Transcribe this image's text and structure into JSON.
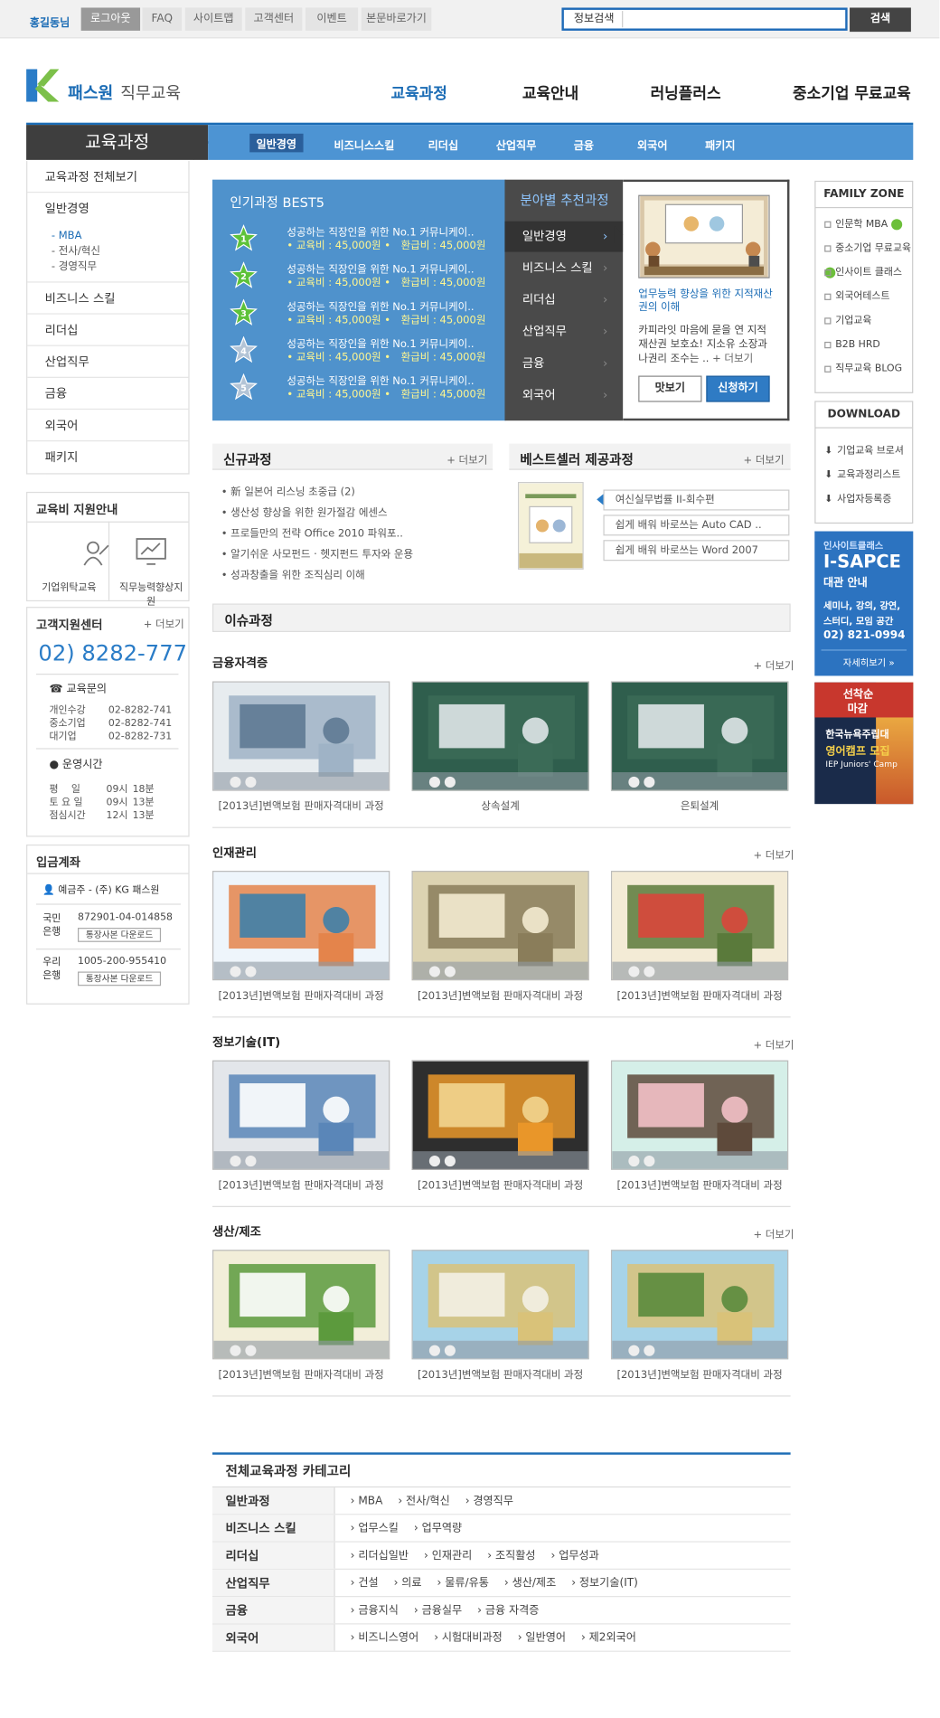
{
  "topbar": {
    "user": "홍길동님",
    "links": [
      "로그아웃",
      "FAQ",
      "사이트맵",
      "고객센터",
      "이벤트",
      "본문바로가기"
    ],
    "search_label": "정보검색",
    "search_value": "",
    "search_button": "검색"
  },
  "header": {
    "brand": "패스원",
    "brand_sub": "직무교육",
    "gnb": [
      "교육과정",
      "교육안내",
      "러닝플러스",
      "중소기업 무료교육"
    ]
  },
  "submenu": {
    "title": "교육과정",
    "items": [
      "일반경영",
      "비즈니스스킬",
      "리더십",
      "산업직무",
      "금융",
      "외국어",
      "패키지"
    ]
  },
  "left_nav": {
    "items": [
      "교육과정 전체보기",
      "일반경영"
    ],
    "subitems": [
      "MBA",
      "전사/혁신",
      "경영직무"
    ],
    "items2": [
      "비즈니스 스킬",
      "리더십",
      "산업직무",
      "금융",
      "외국어",
      "패키지"
    ]
  },
  "support": {
    "title": "교육비 지원안내",
    "items": [
      "기업위탁교육",
      "직무능력향상지원"
    ]
  },
  "customer": {
    "title": "고객지원센터",
    "more": "+ 더보기",
    "phone": "02) 8282-777",
    "inquiry_label": "교육문의",
    "inquiry": [
      {
        "k": "개인수강",
        "v": "02-8282-741"
      },
      {
        "k": "중소기업",
        "v": "02-8282-741"
      },
      {
        "k": "대기업",
        "v": "02-8282-731"
      }
    ],
    "hours_label": "운영시간",
    "hours": [
      {
        "k": "평　 일",
        "a": "09시",
        "b": "18분"
      },
      {
        "k": "토 요 일",
        "a": "09시",
        "b": "13분"
      },
      {
        "k": "점심시간",
        "a": "12시",
        "b": "13분"
      }
    ]
  },
  "bank": {
    "title": "입금계좌",
    "holder": "예금주 - (주) KG 패스원",
    "accounts": [
      {
        "bank": "국민\n은행",
        "no": "872901-04-014858",
        "btn": "통장사본 다운로드"
      },
      {
        "bank": "우리\n은행",
        "no": "1005-200-955410",
        "btn": "통장사본 다운로드"
      }
    ]
  },
  "best5": {
    "title": "인기과정 BEST5",
    "rows": [
      {
        "rank": "1",
        "title": "성공하는 직장인을 위한 No.1 커뮤니케이..",
        "price": "• 교육비 : 45,000원 •　환급비 : 45,000원"
      },
      {
        "rank": "2",
        "title": "성공하는 직장인을 위한 No.1 커뮤니케이..",
        "price": "• 교육비 : 45,000원 •　환급비 : 45,000원"
      },
      {
        "rank": "3",
        "title": "성공하는 직장인을 위한 No.1 커뮤니케이..",
        "price": "• 교육비 : 45,000원 •　환급비 : 45,000원"
      },
      {
        "rank": "4",
        "title": "성공하는 직장인을 위한 No.1 커뮤니케이..",
        "price": "• 교육비 : 45,000원 •　환급비 : 45,000원"
      },
      {
        "rank": "5",
        "title": "성공하는 직장인을 위한 No.1 커뮤니케이..",
        "price": "• 교육비 : 45,000원 •　환급비 : 45,000원"
      }
    ]
  },
  "recommend": {
    "title": "분야별 추천과정",
    "items": [
      "일반경영",
      "비즈니스 스킬",
      "리더십",
      "산업직무",
      "금융",
      "외국어"
    ],
    "detail_title": "업무능력 향상을 위한 지적재산권의 이해",
    "detail_desc": "카피라잇 마음에 묻을 연 지적재산권 보호쇼! 지소유 소장과 나권리 조수는 ..",
    "detail_more": "+ 더보기",
    "btn_preview": "맛보기",
    "btn_apply": "신청하기"
  },
  "new_courses": {
    "title": "신규과정",
    "more": "+ 더보기",
    "items": [
      "新 일본어 리스닝 초중급 (2)",
      "생산성 향상을 위한 원가절감 에센스",
      "프로들만의 전략 Office 2010 파워포..",
      "알기쉬운 사모펀드 · 헷지펀드 투자와 운용",
      "성과창출을 위한 조직심리 이해"
    ]
  },
  "bestseller": {
    "title": "베스트셀러 제공과정",
    "more": "+ 더보기",
    "items": [
      "여신실무법률 II-회수편",
      "쉽게 배워 바로쓰는 Auto CAD ..",
      "쉽게 배워 바로쓰는 Word 2007"
    ]
  },
  "issue": {
    "title": "이슈과정",
    "more": "+ 더보기",
    "sections": [
      {
        "title": "금융자격증",
        "caps": [
          "[2013년]변액보험 판매자격대비 과정",
          "상속설계",
          "은퇴설계"
        ]
      },
      {
        "title": "인재관리",
        "caps": [
          "[2013년]변액보험 판매자격대비 과정",
          "[2013년]변액보험 판매자격대비 과정",
          "[2013년]변액보험 판매자격대비 과정"
        ]
      },
      {
        "title": "정보기술(IT)",
        "caps": [
          "[2013년]변액보험 판매자격대비 과정",
          "[2013년]변액보험 판매자격대비 과정",
          "[2013년]변액보험 판매자격대비 과정"
        ]
      },
      {
        "title": "생산/제조",
        "caps": [
          "[2013년]변액보험 판매자격대비 과정",
          "[2013년]변액보험 판매자격대비 과정",
          "[2013년]변액보험 판매자격대비 과정"
        ]
      }
    ]
  },
  "family_zone": {
    "title": "FAMILY ZONE",
    "items": [
      "인문학 MBA",
      "중소기업 무료교육",
      "인사이트 클래스",
      "외국어테스트",
      "기업교육",
      "B2B HRD",
      "직무교육 BLOG"
    ]
  },
  "download": {
    "title": "DOWNLOAD",
    "items": [
      "기업교육 브로셔",
      "교육과정리스트",
      "사업자등록증"
    ]
  },
  "banner1": {
    "l1": "인사이트클래스",
    "l2": "I-SAPCE",
    "l3": "대관 안내",
    "l4": "세미나, 강의, 강연,",
    "l5": "스터디, 모임 공간",
    "l6": "02) 821-0994",
    "l7": "자세히보기 »"
  },
  "banner2": {
    "l1": "선착순",
    "l2": "마감",
    "l3": "한국뉴욕주립대",
    "l4": "영어캠프 모집",
    "l5": "IEP Juniors' Camp"
  },
  "categories": {
    "title": "전체교육과정 카테고리",
    "rows": [
      {
        "k": "일반과정",
        "v": [
          "› MBA",
          "› 전사/혁신",
          "› 경영직무"
        ]
      },
      {
        "k": "비즈니스 스킬",
        "v": [
          "› 업무스킬",
          "› 업무역량"
        ]
      },
      {
        "k": "리더십",
        "v": [
          "› 리더십일반",
          "› 인재관리",
          "› 조직활성",
          "› 업무성과"
        ]
      },
      {
        "k": "산업직무",
        "v": [
          "› 건설",
          "› 의료",
          "› 물류/유통",
          "› 생산/제조",
          "› 정보기술(IT)"
        ]
      },
      {
        "k": "금융",
        "v": [
          "› 금융지식",
          "› 금융실무",
          "› 금융 자격증"
        ]
      },
      {
        "k": "외국어",
        "v": [
          "› 비즈니스영어",
          "› 시험대비과정",
          "› 일반영어",
          "› 제2외국어"
        ]
      }
    ]
  },
  "colors": {
    "accent": "#1b6cb5",
    "best_bg": "#4f92cc",
    "rec_bg": "#4a4a4a",
    "price": "#fff68f"
  }
}
